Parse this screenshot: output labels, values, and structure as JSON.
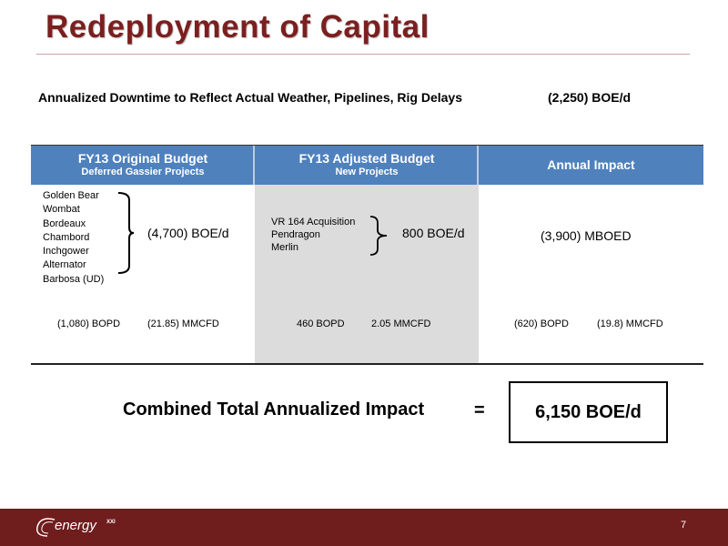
{
  "title": "Redeployment of Capital",
  "downtime": {
    "label": "Annualized Downtime to Reflect Actual Weather, Pipelines, Rig Delays",
    "value": "(2,250) BOE/d"
  },
  "table": {
    "headers": [
      {
        "title": "FY13 Original Budget",
        "subtitle": "Deferred  Gassier Projects"
      },
      {
        "title": "FY13 Adjusted Budget",
        "subtitle": "New Projects"
      },
      {
        "title": "Annual Impact",
        "subtitle": ""
      }
    ],
    "deferred_projects": [
      "Golden Bear",
      "Wombat",
      "Bordeaux",
      "Chambord",
      "Inchgower",
      "Alternator",
      "Barbosa (UD)"
    ],
    "deferred_value": "(4,700) BOE/d",
    "new_projects": [
      "VR 164 Acquisition",
      "Pendragon",
      "Merlin"
    ],
    "new_value": "800 BOE/d",
    "impact_value": "(3,900) MBOED",
    "sub_values": {
      "original_bopd": "(1,080) BOPD",
      "original_mmcfd": "(21.85) MMCFD",
      "adjusted_bopd": "460 BOPD",
      "adjusted_mmcfd": "2.05 MMCFD",
      "impact_bopd": "(620) BOPD",
      "impact_mmcfd": "(19.8) MMCFD"
    }
  },
  "combined": {
    "label": "Combined Total Annualized Impact",
    "equals": "=",
    "value": "6,150 BOE/d"
  },
  "footer": {
    "logo_text": "energy",
    "logo_sup": "XXI",
    "page_number": "7"
  },
  "colors": {
    "title": "#7b1f1f",
    "header_bg": "#4f81bd",
    "footer_bg": "#6f1d1d",
    "shade": "#dcdcdc"
  }
}
